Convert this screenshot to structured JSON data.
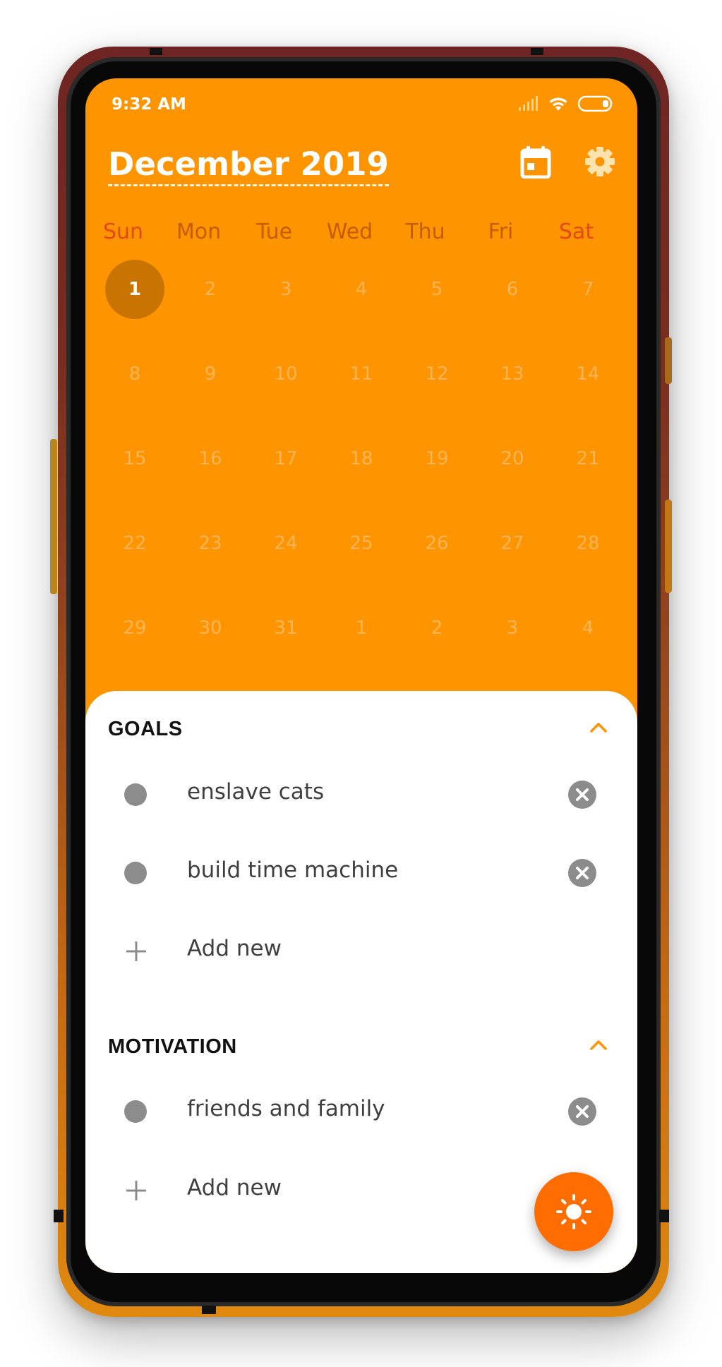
{
  "status_bar": {
    "time": "9:32 AM",
    "icons": [
      "signal-icon",
      "wifi-icon",
      "battery-icon"
    ]
  },
  "header": {
    "title": "December 2019",
    "calendar_icon": "calendar-icon",
    "settings_icon": "gear-icon"
  },
  "calendar": {
    "weekdays": [
      "Sun",
      "Mon",
      "Tue",
      "Wed",
      "Thu",
      "Fri",
      "Sat"
    ],
    "weeks": [
      [
        "1",
        "2",
        "3",
        "4",
        "5",
        "6",
        "7"
      ],
      [
        "8",
        "9",
        "10",
        "11",
        "12",
        "13",
        "14"
      ],
      [
        "15",
        "16",
        "17",
        "18",
        "19",
        "20",
        "21"
      ],
      [
        "22",
        "23",
        "24",
        "25",
        "26",
        "27",
        "28"
      ],
      [
        "29",
        "30",
        "31",
        "1",
        "2",
        "3",
        "4"
      ]
    ],
    "selected_day": "1"
  },
  "sections": [
    {
      "title": "GOALS",
      "items": [
        "enslave cats",
        "build time machine"
      ],
      "add_label": "Add new"
    },
    {
      "title": "MOTIVATION",
      "items": [
        "friends and family"
      ],
      "add_label": "Add new"
    }
  ],
  "fab": {
    "icon": "sun-icon"
  },
  "colors": {
    "accent": "#fe9500",
    "weekend": "#e24b17",
    "fab": "#ff6d00",
    "muted": "#8c8c8c"
  }
}
